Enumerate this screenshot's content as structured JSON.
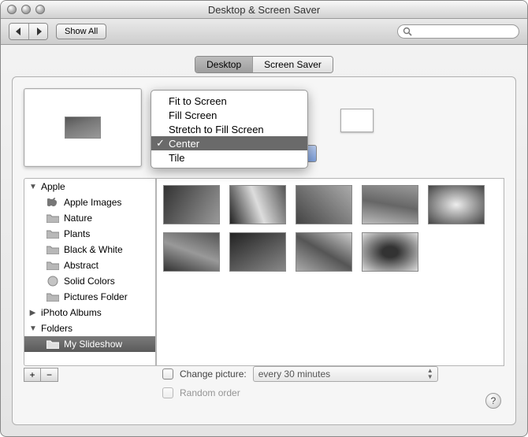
{
  "window": {
    "title": "Desktop & Screen Saver"
  },
  "toolbar": {
    "show_all": "Show All",
    "search_placeholder": ""
  },
  "tabs": {
    "desktop": "Desktop",
    "screensaver": "Screen Saver",
    "active": "Desktop"
  },
  "fit_menu": {
    "items": [
      "Fit to Screen",
      "Fill Screen",
      "Stretch to Fill Screen",
      "Center",
      "Tile"
    ],
    "selected": "Center"
  },
  "sidebar": {
    "apple": {
      "label": "Apple",
      "expanded": true,
      "items": [
        "Apple Images",
        "Nature",
        "Plants",
        "Black & White",
        "Abstract",
        "Solid Colors",
        "Pictures Folder"
      ]
    },
    "iphoto": {
      "label": "iPhoto Albums",
      "expanded": false
    },
    "folders": {
      "label": "Folders",
      "expanded": true,
      "items": [
        "My Slideshow"
      ],
      "selected": "My Slideshow"
    }
  },
  "thumbnails": {
    "row1_count": 5,
    "row2_count": 4
  },
  "options": {
    "change_label": "Change picture:",
    "interval": "every 30 minutes",
    "change_checked": false,
    "random_label": "Random order",
    "random_checked": false
  },
  "help": "?"
}
